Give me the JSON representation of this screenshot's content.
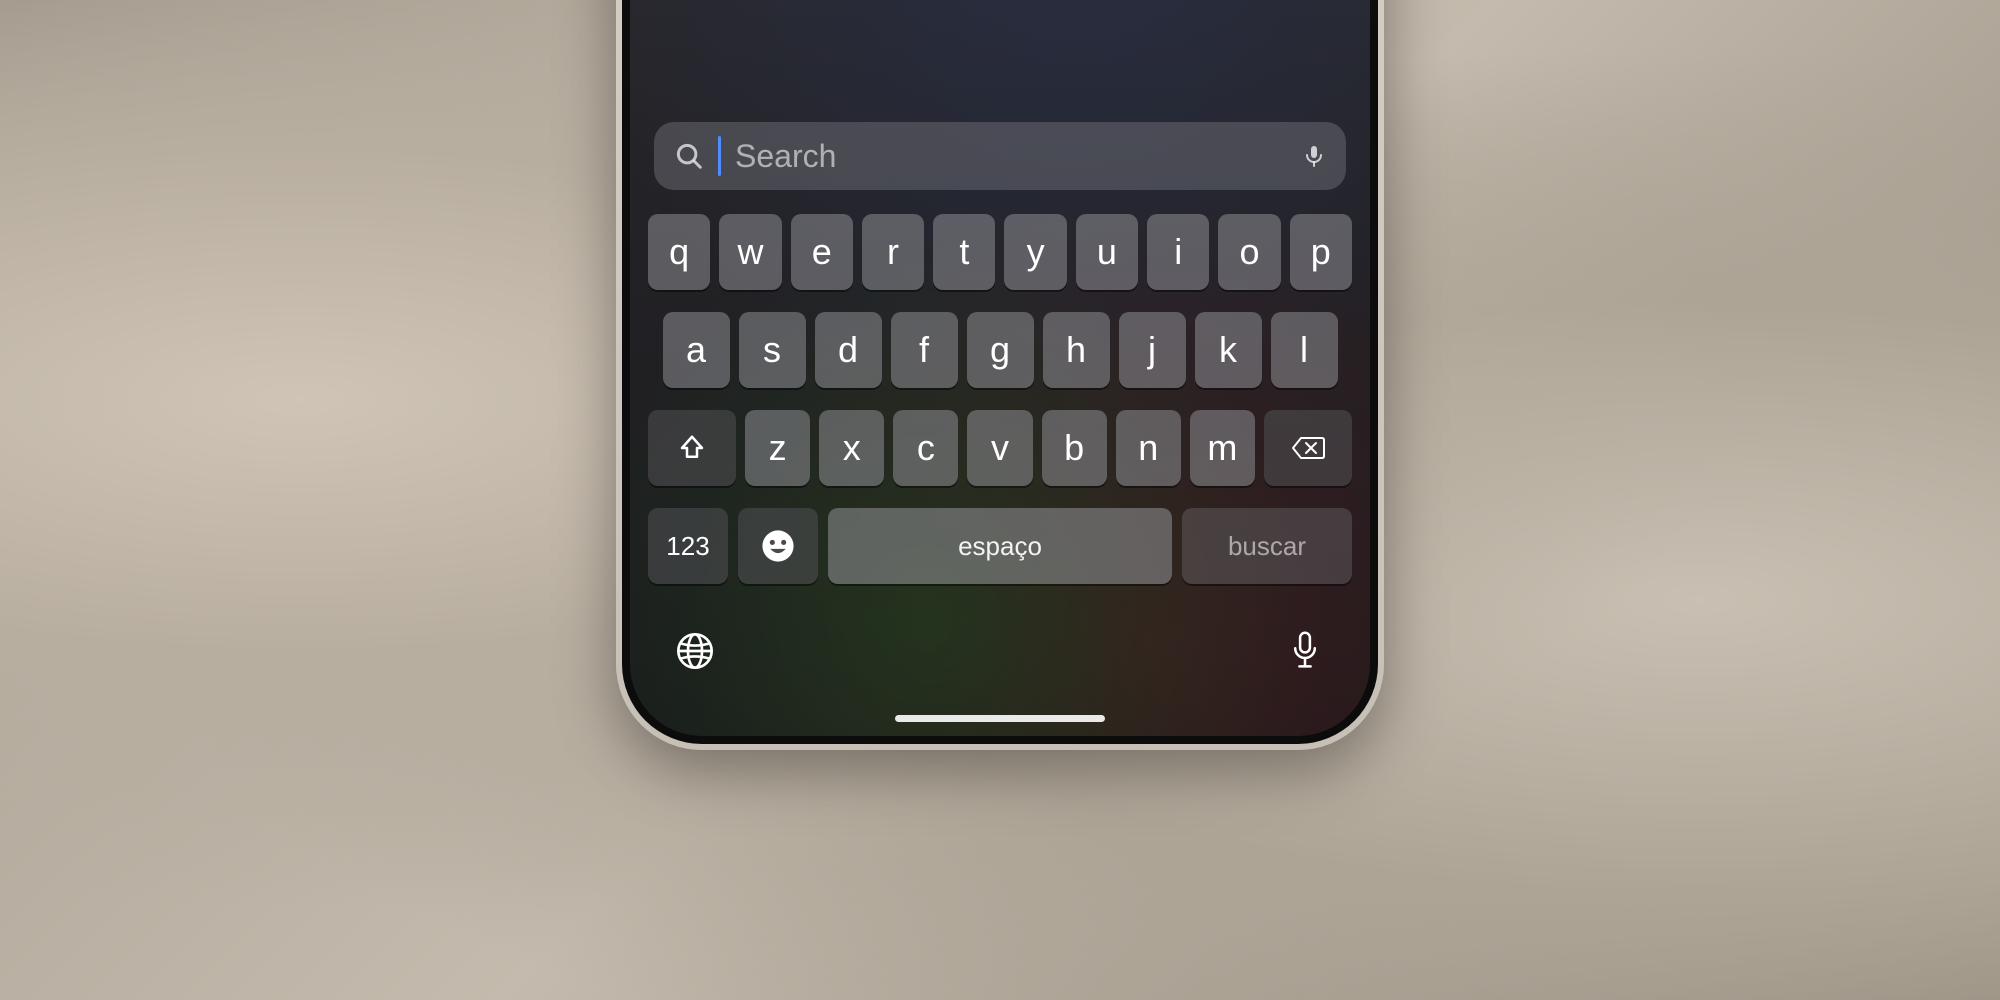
{
  "search": {
    "placeholder": "Search"
  },
  "keyboard": {
    "row1": [
      "q",
      "w",
      "e",
      "r",
      "t",
      "y",
      "u",
      "i",
      "o",
      "p"
    ],
    "row2": [
      "a",
      "s",
      "d",
      "f",
      "g",
      "h",
      "j",
      "k",
      "l"
    ],
    "row3": [
      "z",
      "x",
      "c",
      "v",
      "b",
      "n",
      "m"
    ],
    "numbers_label": "123",
    "space_label": "espaço",
    "search_label": "buscar"
  }
}
